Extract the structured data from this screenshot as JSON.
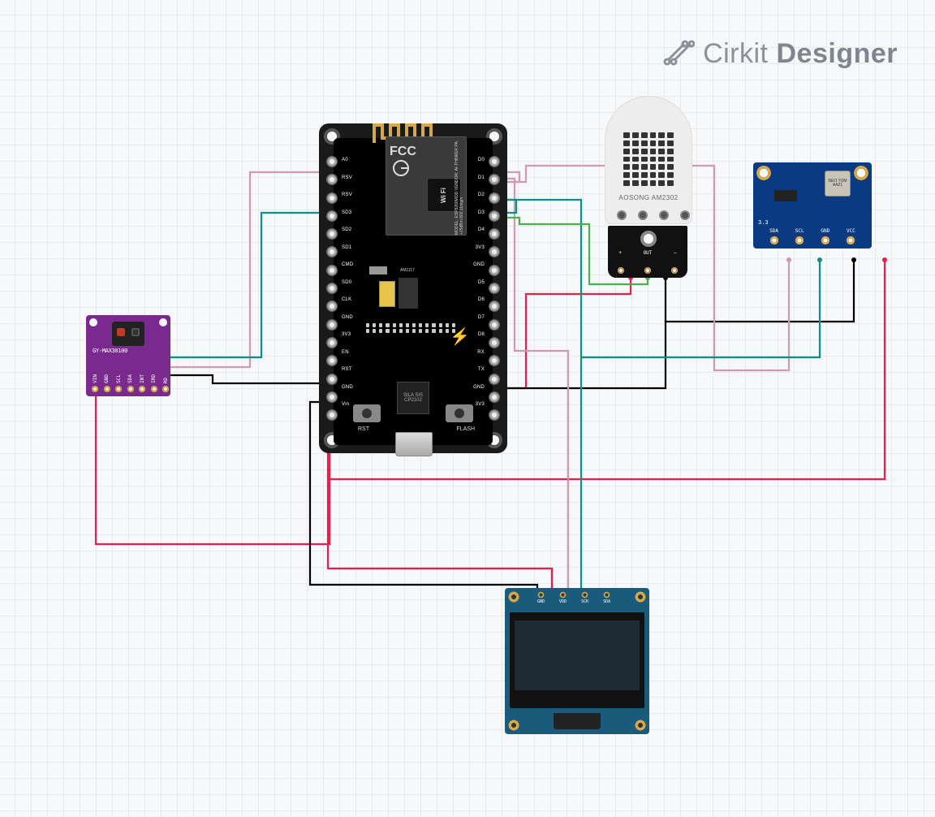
{
  "brand": {
    "light": "Cirkit",
    "bold": "Designer"
  },
  "nodemcu": {
    "left_pins": [
      "A0",
      "RSV",
      "RSV",
      "SD3",
      "SD2",
      "SD1",
      "CMD",
      "SD0",
      "CLK",
      "GND",
      "3V3",
      "EN",
      "RST",
      "GND",
      "Vin"
    ],
    "right_pins": [
      "D0",
      "D1",
      "D2",
      "D3",
      "D4",
      "3V3",
      "GND",
      "D5",
      "D6",
      "D7",
      "D8",
      "RX",
      "TX",
      "GND",
      "3V3"
    ],
    "shield_fcc": "FCC",
    "shield_wifi_tag": "WiFi",
    "shield_side": "MODEL: ESP8266MOD\nVENDOR: AI-THINKER\nPA: +25dBm\n802.11b/g/n",
    "regulator": "AM1117",
    "usb_chip": "SILA SIS\nCP2102",
    "btn_rst": "RST",
    "btn_flash": "FLASH"
  },
  "max30100": {
    "title": "GY-MAX30100",
    "pins": [
      "VIN",
      "GND",
      "SCL",
      "SDA",
      "INT",
      "IRD",
      "RD"
    ]
  },
  "dht22": {
    "am_label": "AOSONG AM2302",
    "silk": [
      "+",
      "OUT",
      "−"
    ]
  },
  "bmp180": {
    "pins": [
      "SDA",
      "SCL",
      "GND",
      "VCC"
    ],
    "txt33": "3.3",
    "chip": "NEO\nTOM\nAA21"
  },
  "oled": {
    "pins": [
      "GND",
      "VDD",
      "SCK",
      "SDA"
    ]
  },
  "wires": {
    "colors": {
      "power": "#e91e4d",
      "ground": "#000000",
      "sda": "#d19ab0",
      "scl": "#0f8f8a",
      "data": "#4caf50"
    }
  }
}
